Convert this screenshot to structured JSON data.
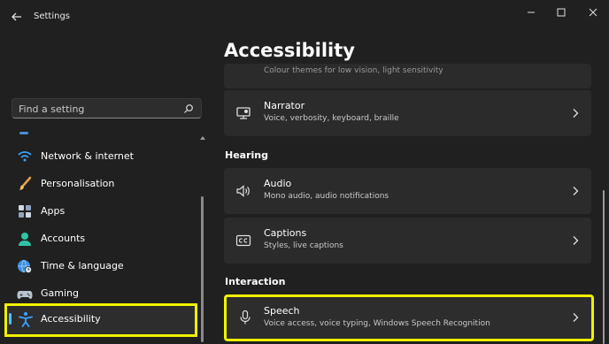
{
  "window": {
    "title": "Settings"
  },
  "search": {
    "placeholder": "Find a setting"
  },
  "sidebar": {
    "items": [
      {
        "label": "Network & internet",
        "icon": "wifi-icon"
      },
      {
        "label": "Personalisation",
        "icon": "brush-icon"
      },
      {
        "label": "Apps",
        "icon": "apps-icon"
      },
      {
        "label": "Accounts",
        "icon": "person-icon"
      },
      {
        "label": "Time & language",
        "icon": "globe-clock-icon"
      },
      {
        "label": "Gaming",
        "icon": "gamepad-icon"
      },
      {
        "label": "Accessibility",
        "icon": "accessibility-icon",
        "selected": true
      }
    ]
  },
  "main": {
    "title": "Accessibility",
    "cut_off_description": "Colour themes for low vision, light sensitivity",
    "cards": [
      {
        "title": "Narrator",
        "description": "Voice, verbosity, keyboard, braille",
        "icon": "narrator-icon"
      },
      {
        "title": "Audio",
        "description": "Mono audio, audio notifications",
        "icon": "speaker-icon"
      },
      {
        "title": "Captions",
        "description": "Styles, live captions",
        "icon": "captions-icon"
      },
      {
        "title": "Speech",
        "description": "Voice access, voice typing, Windows Speech Recognition",
        "icon": "microphone-icon"
      }
    ],
    "sections": {
      "hearing": "Hearing",
      "interaction": "Interaction"
    }
  },
  "colors": {
    "background": "#202020",
    "card": "#2b2b2b",
    "accent": "#4cc2ff",
    "highlight": "#f0f000"
  }
}
